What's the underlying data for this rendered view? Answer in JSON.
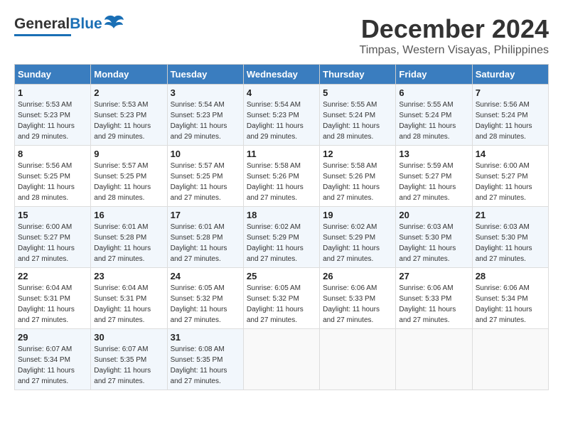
{
  "header": {
    "logo_general": "General",
    "logo_blue": "Blue",
    "title": "December 2024",
    "subtitle": "Timpas, Western Visayas, Philippines"
  },
  "days_of_week": [
    "Sunday",
    "Monday",
    "Tuesday",
    "Wednesday",
    "Thursday",
    "Friday",
    "Saturday"
  ],
  "weeks": [
    [
      {
        "day": "1",
        "info": "Sunrise: 5:53 AM\nSunset: 5:23 PM\nDaylight: 11 hours and 29 minutes."
      },
      {
        "day": "2",
        "info": "Sunrise: 5:53 AM\nSunset: 5:23 PM\nDaylight: 11 hours and 29 minutes."
      },
      {
        "day": "3",
        "info": "Sunrise: 5:54 AM\nSunset: 5:23 PM\nDaylight: 11 hours and 29 minutes."
      },
      {
        "day": "4",
        "info": "Sunrise: 5:54 AM\nSunset: 5:23 PM\nDaylight: 11 hours and 29 minutes."
      },
      {
        "day": "5",
        "info": "Sunrise: 5:55 AM\nSunset: 5:24 PM\nDaylight: 11 hours and 28 minutes."
      },
      {
        "day": "6",
        "info": "Sunrise: 5:55 AM\nSunset: 5:24 PM\nDaylight: 11 hours and 28 minutes."
      },
      {
        "day": "7",
        "info": "Sunrise: 5:56 AM\nSunset: 5:24 PM\nDaylight: 11 hours and 28 minutes."
      }
    ],
    [
      {
        "day": "8",
        "info": "Sunrise: 5:56 AM\nSunset: 5:25 PM\nDaylight: 11 hours and 28 minutes."
      },
      {
        "day": "9",
        "info": "Sunrise: 5:57 AM\nSunset: 5:25 PM\nDaylight: 11 hours and 28 minutes."
      },
      {
        "day": "10",
        "info": "Sunrise: 5:57 AM\nSunset: 5:25 PM\nDaylight: 11 hours and 27 minutes."
      },
      {
        "day": "11",
        "info": "Sunrise: 5:58 AM\nSunset: 5:26 PM\nDaylight: 11 hours and 27 minutes."
      },
      {
        "day": "12",
        "info": "Sunrise: 5:58 AM\nSunset: 5:26 PM\nDaylight: 11 hours and 27 minutes."
      },
      {
        "day": "13",
        "info": "Sunrise: 5:59 AM\nSunset: 5:27 PM\nDaylight: 11 hours and 27 minutes."
      },
      {
        "day": "14",
        "info": "Sunrise: 6:00 AM\nSunset: 5:27 PM\nDaylight: 11 hours and 27 minutes."
      }
    ],
    [
      {
        "day": "15",
        "info": "Sunrise: 6:00 AM\nSunset: 5:27 PM\nDaylight: 11 hours and 27 minutes."
      },
      {
        "day": "16",
        "info": "Sunrise: 6:01 AM\nSunset: 5:28 PM\nDaylight: 11 hours and 27 minutes."
      },
      {
        "day": "17",
        "info": "Sunrise: 6:01 AM\nSunset: 5:28 PM\nDaylight: 11 hours and 27 minutes."
      },
      {
        "day": "18",
        "info": "Sunrise: 6:02 AM\nSunset: 5:29 PM\nDaylight: 11 hours and 27 minutes."
      },
      {
        "day": "19",
        "info": "Sunrise: 6:02 AM\nSunset: 5:29 PM\nDaylight: 11 hours and 27 minutes."
      },
      {
        "day": "20",
        "info": "Sunrise: 6:03 AM\nSunset: 5:30 PM\nDaylight: 11 hours and 27 minutes."
      },
      {
        "day": "21",
        "info": "Sunrise: 6:03 AM\nSunset: 5:30 PM\nDaylight: 11 hours and 27 minutes."
      }
    ],
    [
      {
        "day": "22",
        "info": "Sunrise: 6:04 AM\nSunset: 5:31 PM\nDaylight: 11 hours and 27 minutes."
      },
      {
        "day": "23",
        "info": "Sunrise: 6:04 AM\nSunset: 5:31 PM\nDaylight: 11 hours and 27 minutes."
      },
      {
        "day": "24",
        "info": "Sunrise: 6:05 AM\nSunset: 5:32 PM\nDaylight: 11 hours and 27 minutes."
      },
      {
        "day": "25",
        "info": "Sunrise: 6:05 AM\nSunset: 5:32 PM\nDaylight: 11 hours and 27 minutes."
      },
      {
        "day": "26",
        "info": "Sunrise: 6:06 AM\nSunset: 5:33 PM\nDaylight: 11 hours and 27 minutes."
      },
      {
        "day": "27",
        "info": "Sunrise: 6:06 AM\nSunset: 5:33 PM\nDaylight: 11 hours and 27 minutes."
      },
      {
        "day": "28",
        "info": "Sunrise: 6:06 AM\nSunset: 5:34 PM\nDaylight: 11 hours and 27 minutes."
      }
    ],
    [
      {
        "day": "29",
        "info": "Sunrise: 6:07 AM\nSunset: 5:34 PM\nDaylight: 11 hours and 27 minutes."
      },
      {
        "day": "30",
        "info": "Sunrise: 6:07 AM\nSunset: 5:35 PM\nDaylight: 11 hours and 27 minutes."
      },
      {
        "day": "31",
        "info": "Sunrise: 6:08 AM\nSunset: 5:35 PM\nDaylight: 11 hours and 27 minutes."
      },
      {
        "day": "",
        "info": ""
      },
      {
        "day": "",
        "info": ""
      },
      {
        "day": "",
        "info": ""
      },
      {
        "day": "",
        "info": ""
      }
    ]
  ]
}
